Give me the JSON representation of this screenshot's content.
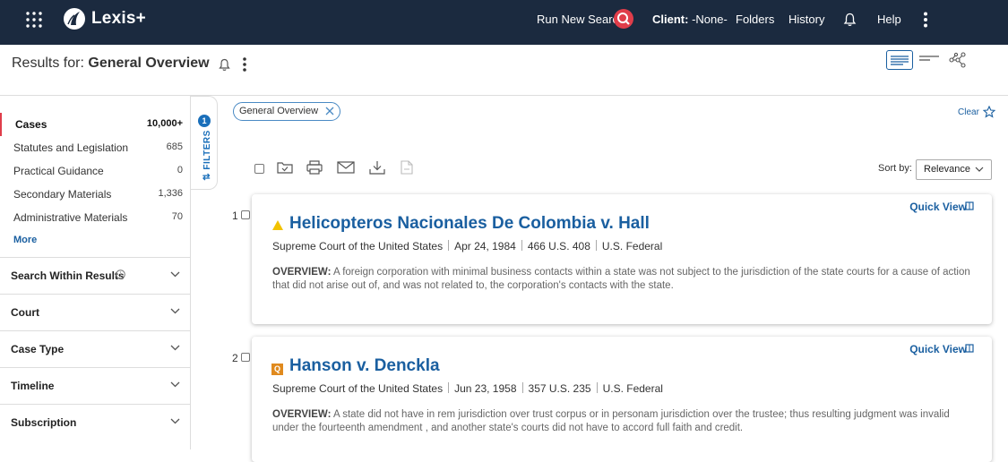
{
  "nav": {
    "brand": "Lexis+",
    "run_search": "Run New Search",
    "client_label": "Client:",
    "client_value": "-None-",
    "folders": "Folders",
    "history": "History",
    "help": "Help"
  },
  "header": {
    "results_prefix": "Results for:",
    "query": "General Overview"
  },
  "sidebar": {
    "categories": [
      {
        "label": "Cases",
        "count": "10,000+"
      },
      {
        "label": "Statutes and Legislation",
        "count": "685"
      },
      {
        "label": "Practical Guidance",
        "count": "0"
      },
      {
        "label": "Secondary Materials",
        "count": "1,336"
      },
      {
        "label": "Administrative Materials",
        "count": "70"
      }
    ],
    "more": "More",
    "facets": [
      "Search Within Results",
      "Court",
      "Case Type",
      "Timeline",
      "Subscription"
    ]
  },
  "filters": {
    "count": "1",
    "label": "FILTERS"
  },
  "chip": "General Overview",
  "clear": "Clear",
  "sort": {
    "label": "Sort by:",
    "value": "Relevance"
  },
  "quick_view": "Quick View",
  "results": [
    {
      "num": "1",
      "title": "Helicopteros Nacionales De Colombia v. Hall",
      "court": "Supreme Court of the United States",
      "date": "Apr 24, 1984",
      "cite": "466 U.S. 408",
      "jurisdiction": "U.S. Federal",
      "overview_label": "OVERVIEW:",
      "overview": "A foreign corporation with minimal business contacts within a state was not subject to the jurisdiction of the state courts for a cause of action that did not arise out of, and was not related to, the corporation's contacts with the state."
    },
    {
      "num": "2",
      "title": "Hanson v. Denckla",
      "court": "Supreme Court of the United States",
      "date": "Jun 23, 1958",
      "cite": "357 U.S. 235",
      "jurisdiction": "U.S. Federal",
      "overview_label": "OVERVIEW:",
      "overview": "A state did not have in rem jurisdiction over trust corpus or in personam jurisdiction over the trustee; thus resulting judgment was invalid under the fourteenth amendment , and another state's courts did not have to accord full faith and credit."
    }
  ],
  "colors": {
    "nav_bg": "#1b2a3f",
    "link": "#1a5fa0",
    "accent_red": "#e03d4a",
    "warning": "#f2c200",
    "q_badge": "#e08a1e"
  },
  "icons": [
    "app-grid-icon",
    "lexis-logo-icon",
    "search-icon",
    "bell-icon",
    "kebab-menu-icon",
    "list-view-icon",
    "compact-view-icon",
    "graph-view-icon",
    "info-icon",
    "chevron-down-icon",
    "close-icon",
    "star-icon",
    "folder-icon",
    "print-icon",
    "email-icon",
    "download-icon",
    "document-icon",
    "warning-icon",
    "quick-view-icon"
  ]
}
